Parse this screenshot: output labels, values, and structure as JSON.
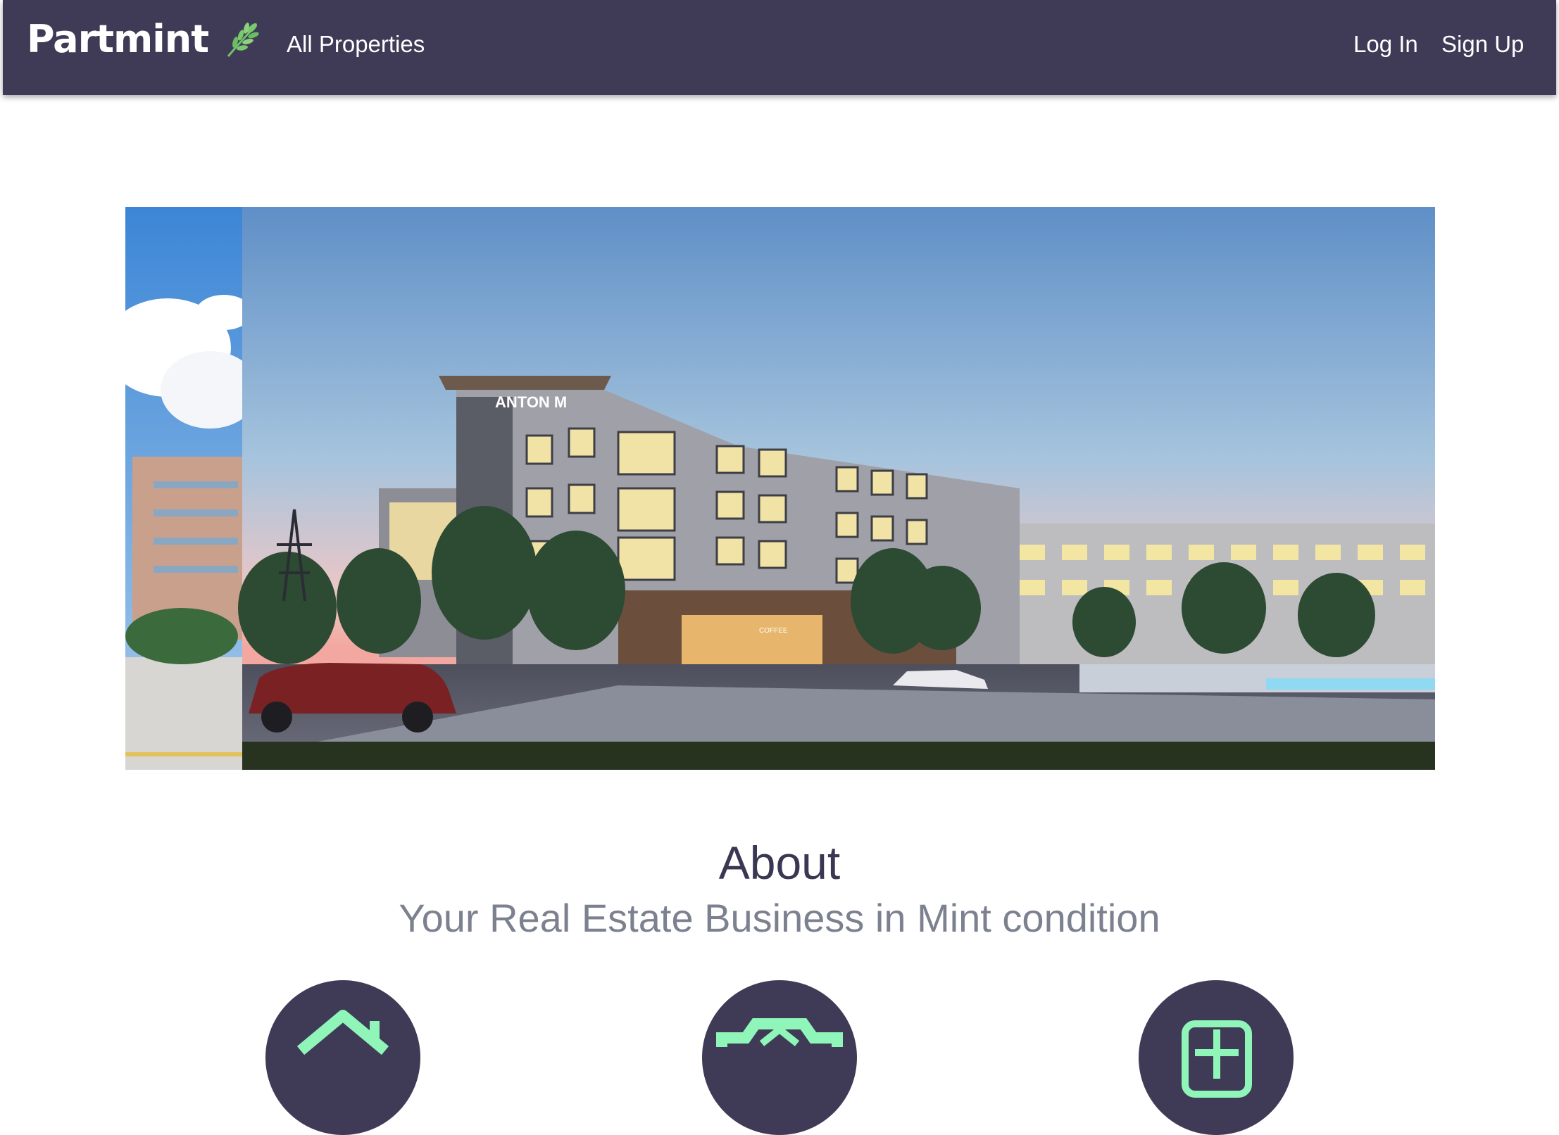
{
  "navbar": {
    "brand": "Partmint",
    "brand_icon": "leaf-icon",
    "links": {
      "all_properties": "All Properties",
      "log_in": "Log In",
      "sign_up": "Sign Up"
    },
    "background_color": "#3f3b57"
  },
  "carousel": {
    "building_sign": "ANTON M",
    "shop_sign": "COFFEE"
  },
  "about": {
    "title": "About",
    "subtitle": "Your Real Estate Business in Mint condition"
  },
  "features": [
    {
      "icon": "home-icon"
    },
    {
      "icon": "camera-home-icon"
    },
    {
      "icon": "add-square-icon"
    }
  ],
  "colors": {
    "accent_mint": "#8ff5b8",
    "dark": "#3f3b57"
  }
}
